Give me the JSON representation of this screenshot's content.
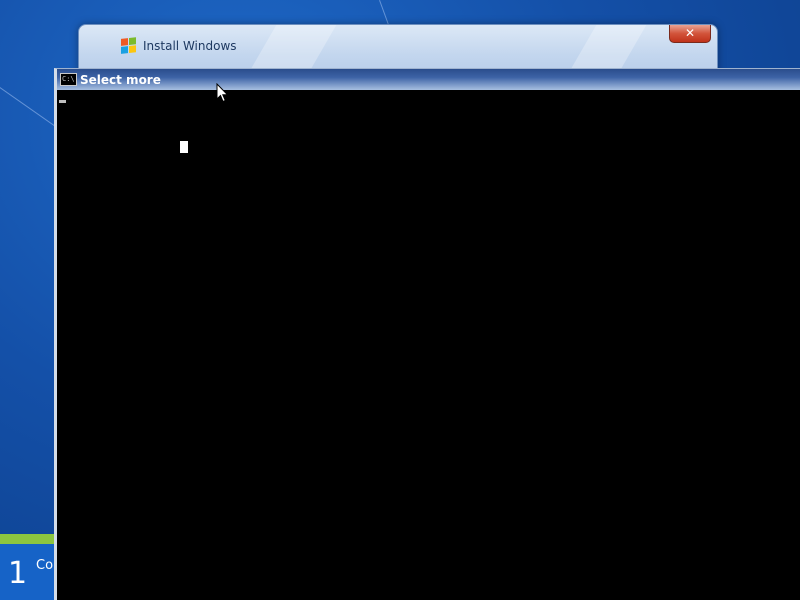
{
  "desktop": {
    "background_color": "#1450a8"
  },
  "install_window": {
    "title": "Install Windows",
    "icon": "windows-flag-icon",
    "close_label": "✕"
  },
  "setup_progress": {
    "step_number": "1",
    "step_text": "Co",
    "accent_color": "#8cc63f"
  },
  "console_window": {
    "title": "Select more",
    "icon": "cmd-icon",
    "icon_text": "C:\\",
    "background_color": "#000000"
  },
  "pointer": {
    "icon": "mouse-pointer-icon"
  }
}
